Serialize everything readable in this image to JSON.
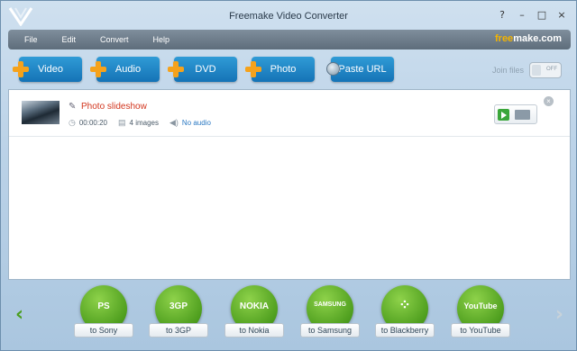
{
  "window": {
    "title": "Freemake Video Converter"
  },
  "menu": {
    "items": [
      "File",
      "Edit",
      "Convert",
      "Help"
    ],
    "brand_part1": "free",
    "brand_part2": "make.com"
  },
  "toolbar": {
    "buttons": [
      {
        "label": "Video",
        "icon": "plus-icon"
      },
      {
        "label": "Audio",
        "icon": "plus-icon"
      },
      {
        "label": "DVD",
        "icon": "plus-icon"
      },
      {
        "label": "Photo",
        "icon": "plus-icon"
      },
      {
        "label": "Paste URL",
        "icon": "globe-icon"
      }
    ],
    "join_files_label": "Join files",
    "join_toggle_state": "OFF"
  },
  "files": [
    {
      "title": "Photo slideshow",
      "duration": "00:00:20",
      "frames": "4 images",
      "audio": "No audio"
    }
  ],
  "targets": {
    "items": [
      {
        "label": "to Sony",
        "logo": "PS"
      },
      {
        "label": "to 3GP",
        "logo": "3GP"
      },
      {
        "label": "to Nokia",
        "logo": "NOKIA"
      },
      {
        "label": "to Samsung",
        "logo": "SAMSUNG"
      },
      {
        "label": "to Blackberry",
        "logo": "⁘"
      },
      {
        "label": "to YouTube",
        "logo": "YouTube"
      }
    ]
  },
  "colors": {
    "accent": "#1e85c8",
    "plus": "#f5a21b",
    "file_title": "#d2351d",
    "target_green": "#5fae2a",
    "brand_yellow": "#f4b400"
  }
}
